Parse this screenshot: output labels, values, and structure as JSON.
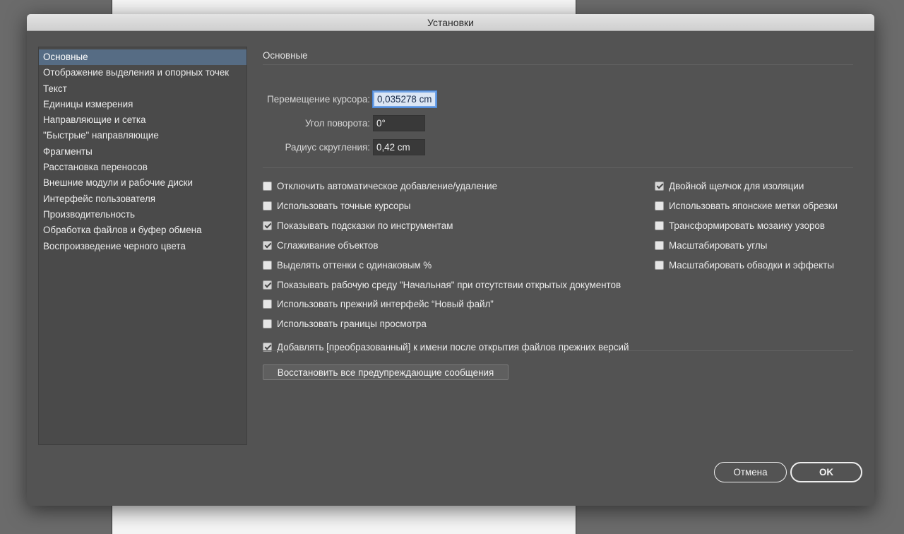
{
  "window": {
    "title": "Установки"
  },
  "sidebar": {
    "items": [
      {
        "label": "Основные"
      },
      {
        "label": "Отображение выделения и опорных точек"
      },
      {
        "label": "Текст"
      },
      {
        "label": "Единицы измерения"
      },
      {
        "label": "Направляющие и сетка"
      },
      {
        "label": "\"Быстрые\" направляющие"
      },
      {
        "label": "Фрагменты"
      },
      {
        "label": "Расстановка переносов"
      },
      {
        "label": "Внешние модули и рабочие диски"
      },
      {
        "label": "Интерфейс пользователя"
      },
      {
        "label": "Производительность"
      },
      {
        "label": "Обработка файлов и буфер обмена"
      },
      {
        "label": "Воспроизведение черного цвета"
      }
    ],
    "active_index": 0
  },
  "section": {
    "title": "Основные"
  },
  "fields": {
    "cursor_move": {
      "label": "Перемещение курсора:",
      "value": "0,035278 cm"
    },
    "rotation": {
      "label": "Угол поворота:",
      "value": "0°"
    },
    "corner_radius": {
      "label": "Радиус скругления:",
      "value": "0,42 cm"
    }
  },
  "checkboxes": {
    "left": [
      {
        "label": "Отключить автоматическое добавление/удаление",
        "checked": false
      },
      {
        "label": "Использовать точные курсоры",
        "checked": false
      },
      {
        "label": "Показывать подсказки по инструментам",
        "checked": true
      },
      {
        "label": "Сглаживание объектов",
        "checked": true
      },
      {
        "label": "Выделять оттенки с одинаковым %",
        "checked": false
      },
      {
        "label": "Показывать рабочую среду \"Начальная\" при отсутствии открытых документов",
        "checked": true
      },
      {
        "label": "Использовать прежний интерфейс “Новый файл”",
        "checked": false
      },
      {
        "label": "Использовать границы просмотра",
        "checked": false
      }
    ],
    "right": [
      {
        "label": "Двойной щелчок для изоляции",
        "checked": true
      },
      {
        "label": "Использовать японские метки обрезки",
        "checked": false
      },
      {
        "label": "Трансформировать мозаику узоров",
        "checked": false
      },
      {
        "label": "Масштабировать углы",
        "checked": false
      },
      {
        "label": "Масштабировать обводки и эффекты",
        "checked": false
      }
    ],
    "legacy": {
      "label": "Добавлять [преобразованный] к имени после открытия файлов прежних версий",
      "checked": true
    }
  },
  "buttons": {
    "reset_warnings": "Восстановить все предупреждающие сообщения",
    "cancel": "Отмена",
    "ok": "OK"
  }
}
